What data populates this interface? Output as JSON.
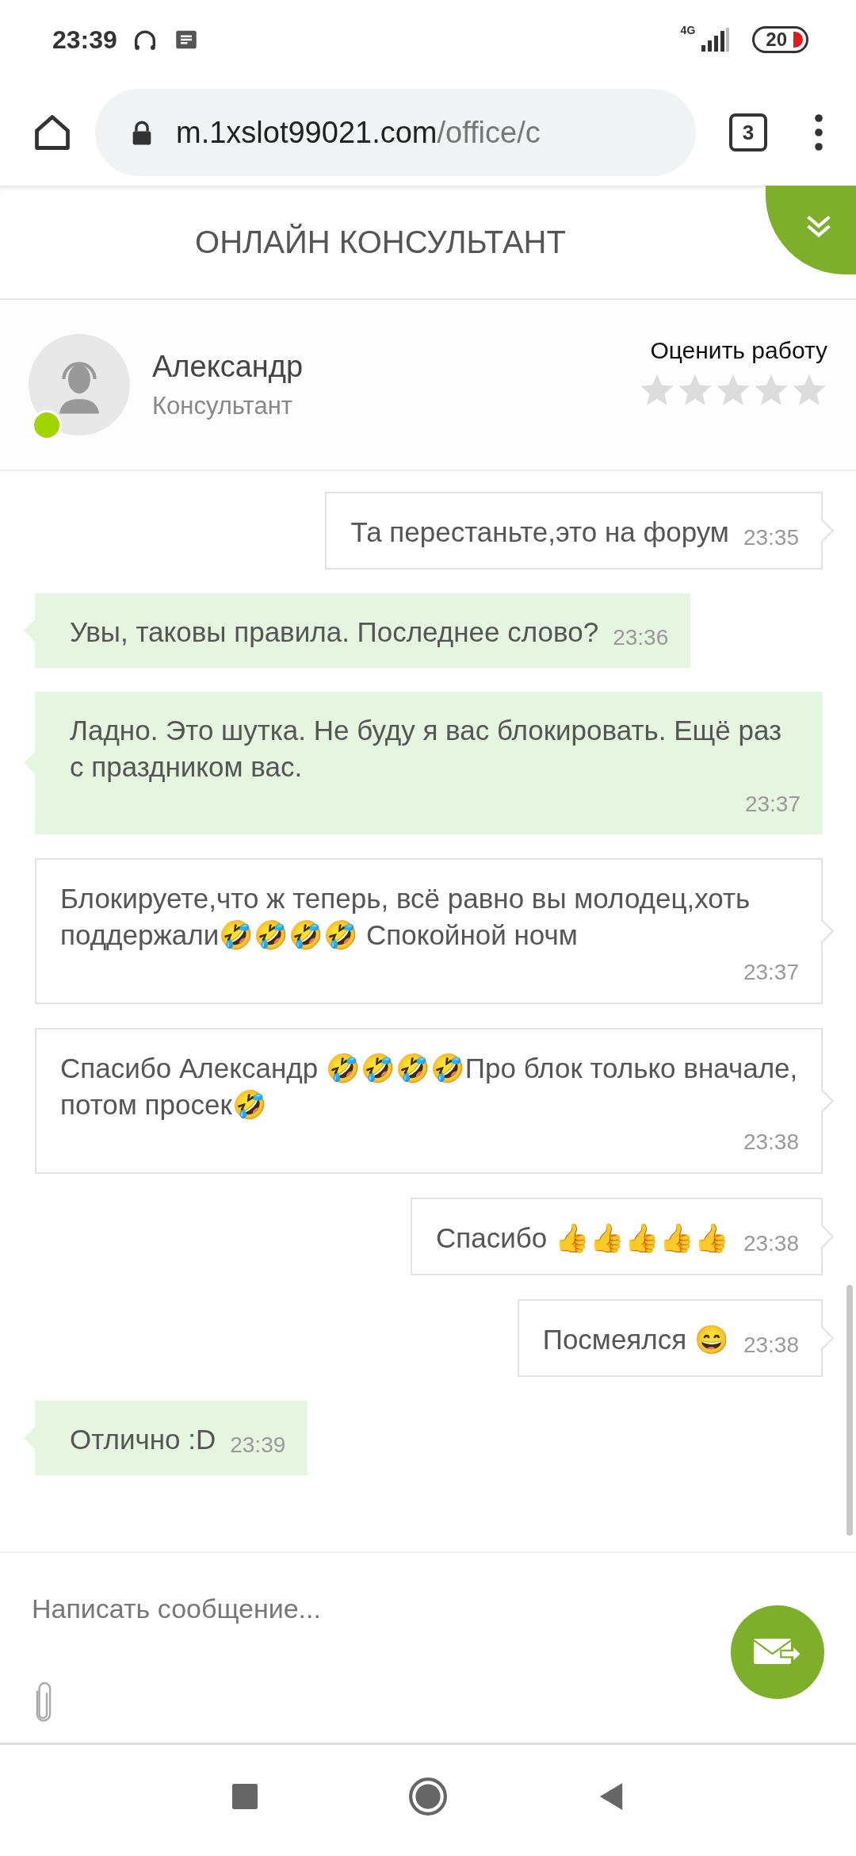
{
  "status_bar": {
    "time": "23:39",
    "network": "4G",
    "battery": "20"
  },
  "browser": {
    "url_host": "m.1xslot99021.com",
    "url_path": "/office/c",
    "tab_count": "3"
  },
  "header": {
    "title": "ОНЛАЙН КОНСУЛЬТАНТ"
  },
  "agent": {
    "name": "Александр",
    "role": "Консультант",
    "online": true,
    "rate_label": "Оценить работу",
    "stars": 0
  },
  "messages": [
    {
      "kind": "user",
      "text": "Та перестаньте,это на форум",
      "time": "23:35"
    },
    {
      "kind": "agent",
      "text": "Увы, таковы правила. Последнее слово?",
      "time": "23:36"
    },
    {
      "kind": "agent",
      "text": "Ладно. Это шутка. Не буду я вас блокировать. Ещё раз с праздником вас.",
      "time": "23:37"
    },
    {
      "kind": "user",
      "text": "Блокируете,что ж теперь, всё равно вы молодец,хоть поддержали🤣🤣🤣🤣 Спокойной ночм",
      "time": "23:37"
    },
    {
      "kind": "user",
      "text": "Спасибо Александр 🤣🤣🤣🤣Про блок только вначале, потом просек🤣",
      "time": "23:38"
    },
    {
      "kind": "user",
      "text": "Спасибо 👍👍👍👍👍",
      "time": "23:38"
    },
    {
      "kind": "user",
      "text": "Посмеялся 😄",
      "time": "23:38"
    },
    {
      "kind": "agent",
      "text": "Отлично :D",
      "time": "23:39"
    }
  ],
  "composer": {
    "placeholder": "Написать сообщение..."
  }
}
